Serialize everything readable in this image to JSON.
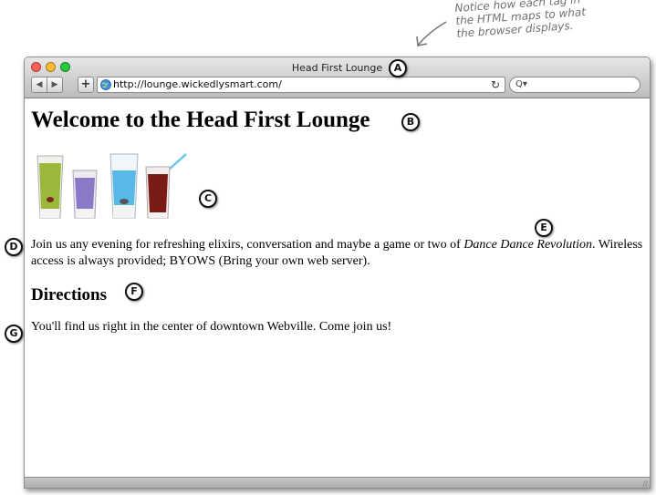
{
  "annotation_note": [
    "Notice how each tag in",
    "the HTML maps to what",
    "the browser displays."
  ],
  "window": {
    "title": "Head First Lounge",
    "url": "http://lounge.wickedlysmart.com/",
    "search_label": "Q▾"
  },
  "page": {
    "heading": "Welcome to the Head First Lounge",
    "intro_before": "Join us any evening for refreshing elixirs, conversation and maybe a game or two of ",
    "intro_emphasis": "Dance Dance Revolution",
    "intro_after": ". Wireless access is always provided; BYOWS (Bring your own web server).",
    "subheading": "Directions",
    "directions": "You'll find us right in the center of downtown Webville. Come join us!"
  },
  "markers": {
    "a": "A",
    "b": "B",
    "c": "C",
    "d": "D",
    "e": "E",
    "f": "F",
    "g": "G"
  },
  "colors": {
    "traffic_close": "#ff5f57",
    "traffic_minimize": "#febc2e",
    "traffic_zoom": "#28c840",
    "drink_green": "#9bb83a",
    "drink_purple": "#8a78c8",
    "drink_blue": "#58b8e8",
    "drink_red": "#7a1c16"
  },
  "icons": {
    "back": "back-arrow-icon",
    "forward": "forward-arrow-icon",
    "add": "plus-icon",
    "site": "globe-icon",
    "reload": "reload-icon",
    "search": "search-icon",
    "resize": "resize-grip-icon"
  }
}
